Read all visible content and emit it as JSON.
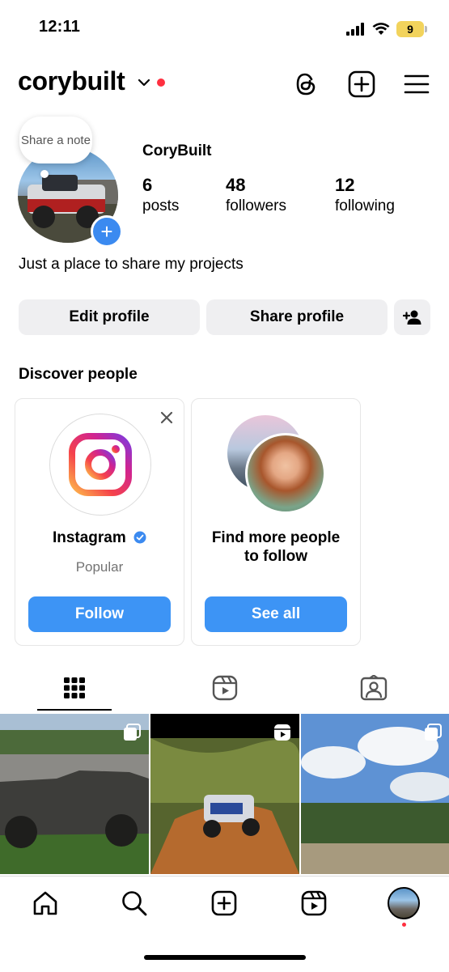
{
  "status_bar": {
    "time": "12:11",
    "battery": "9"
  },
  "header": {
    "username": "corybuilt"
  },
  "note": {
    "text": "Share a note"
  },
  "profile": {
    "display_name": "CoryBuilt",
    "stats": [
      {
        "value": "6",
        "label": "posts"
      },
      {
        "value": "48",
        "label": "followers"
      },
      {
        "value": "12",
        "label": "following"
      }
    ],
    "bio": "Just a place to share my projects"
  },
  "buttons": {
    "edit": "Edit profile",
    "share": "Share profile"
  },
  "discover": {
    "title": "Discover people",
    "cards": [
      {
        "title": "Instagram",
        "subtitle": "Popular",
        "button": "Follow",
        "verified": true
      },
      {
        "title": "Find more people to follow",
        "button": "See all"
      }
    ]
  },
  "tabs": [
    "posts-grid-icon",
    "reels-icon",
    "tagged-icon"
  ],
  "nav": [
    "home-icon",
    "search-icon",
    "create-icon",
    "reels-icon",
    "profile-avatar"
  ],
  "colors": {
    "accent": "#3d94f5",
    "notification": "#ff3040",
    "button_bg": "#efeff1"
  }
}
